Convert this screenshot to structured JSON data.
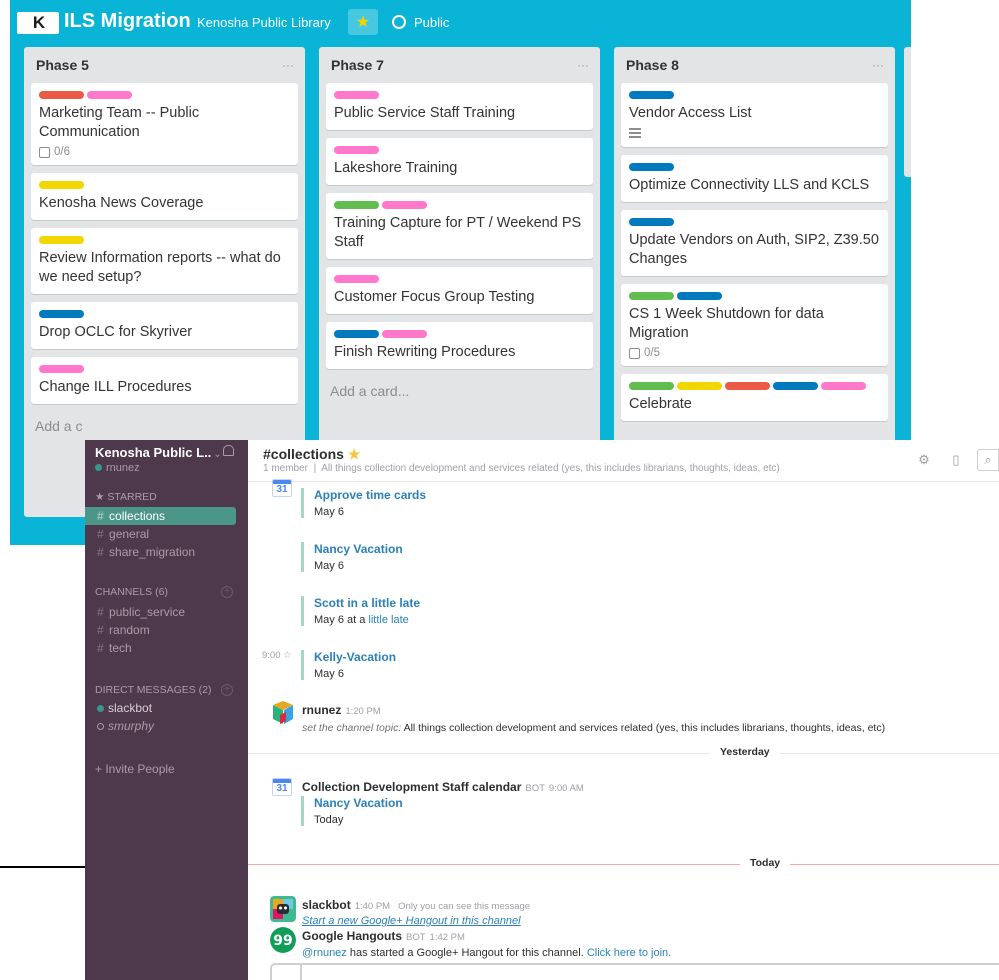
{
  "trello": {
    "logo": "K",
    "board_title": "ILS Migration",
    "org": "Kenosha Public Library",
    "visibility": "Public",
    "colors": {
      "background": "#0ab4d6",
      "green": "#61bd4f",
      "yellow": "#f2d600",
      "red": "#eb5a46",
      "blue": "#0079bf",
      "pink": "#ff78cb"
    },
    "add_card_label": "Add a card...",
    "add_card_partial": "Add a c",
    "lists": [
      {
        "title": "Phase 5",
        "cards": [
          {
            "title": "Marketing Team -- Public Communication",
            "labels": [
              "red",
              "pink"
            ],
            "checklist": "0/6"
          },
          {
            "title": "Kenosha News Coverage",
            "labels": [
              "yellow"
            ]
          },
          {
            "title": "Review Information reports -- what do we need setup?",
            "labels": [
              "yellow"
            ]
          },
          {
            "title": "Drop OCLC for Skyriver",
            "labels": [
              "blue"
            ]
          },
          {
            "title": "Change ILL Procedures",
            "labels": [
              "pink"
            ]
          }
        ]
      },
      {
        "title": "Phase 7",
        "cards": [
          {
            "title": "Public Service Staff Training",
            "labels": [
              "pink"
            ]
          },
          {
            "title": "Lakeshore Training",
            "labels": [
              "pink"
            ]
          },
          {
            "title": "Training Capture for PT / Weekend PS Staff",
            "labels": [
              "green",
              "pink"
            ]
          },
          {
            "title": "Customer Focus Group Testing",
            "labels": [
              "pink"
            ]
          },
          {
            "title": "Finish Rewriting Procedures",
            "labels": [
              "blue",
              "pink"
            ]
          }
        ]
      },
      {
        "title": "Phase 8",
        "cards": [
          {
            "title": "Vendor Access List",
            "labels": [
              "blue"
            ],
            "description": true
          },
          {
            "title": "Optimize Connectivity LLS and KCLS",
            "labels": [
              "blue"
            ]
          },
          {
            "title": "Update Vendors on Auth, SIP2, Z39.50 Changes",
            "labels": [
              "blue"
            ]
          },
          {
            "title": "CS 1 Week Shutdown for data Migration",
            "labels": [
              "green",
              "blue"
            ],
            "checklist": "0/5"
          },
          {
            "title": "Celebrate",
            "labels": [
              "green",
              "yellow",
              "red",
              "blue",
              "pink"
            ]
          }
        ]
      }
    ]
  },
  "slack": {
    "team_name": "Kenosha Public L..",
    "caret": "⌄",
    "username": "rnunez",
    "starred_label": "STARRED",
    "starred": [
      {
        "name": "collections",
        "active": true
      },
      {
        "name": "general"
      },
      {
        "name": "share_migration"
      }
    ],
    "channels_label": "CHANNELS",
    "channels_count": "(6)",
    "channels": [
      "public_service",
      "random",
      "tech"
    ],
    "dm_label": "DIRECT MESSAGES",
    "dm_count": "(2)",
    "dms": [
      {
        "name": "slackbot",
        "status": "online"
      },
      {
        "name": "smurphy",
        "status": "away"
      }
    ],
    "invite": "+ Invite People",
    "channel": {
      "name": "#collections",
      "star": "★",
      "members": "1 member",
      "topic": "All things collection development and services related (yes, this includes librarians, thoughts, ideas, etc)"
    },
    "cal_day": "31",
    "events_top": [
      {
        "title": "Approve time cards",
        "date": "May 6"
      },
      {
        "title": "Nancy Vacation",
        "date": "May 6"
      },
      {
        "title": "Scott in a little late",
        "date_prefix": "May 6 at a ",
        "date_link": "little late"
      },
      {
        "title": "Kelly-Vacation",
        "date": "May 6",
        "time": "9:00",
        "star": "☆"
      }
    ],
    "topic_message": {
      "author": "rnunez",
      "time": "1:20 PM",
      "action": "set the channel topic:",
      "text": "All things collection development and services related (yes, this includes librarians, thoughts, ideas, etc)"
    },
    "divider_yesterday": "Yesterday",
    "calendar_message": {
      "author": "Collection Development Staff calendar",
      "bot": "BOT",
      "time": "9:00 AM",
      "event_title": "Nancy Vacation",
      "event_date": "Today"
    },
    "divider_today": "Today",
    "slackbot_message": {
      "author": "slackbot",
      "time": "1:40 PM",
      "note": "Only you can see this message",
      "link": "Start a new Google+ Hangout in this channel"
    },
    "hangouts_message": {
      "author": "Google Hangouts",
      "bot": "BOT",
      "time": "1:42 PM",
      "mention": "@rnunez",
      "text": " has started a Google+ Hangout for this channel. ",
      "link": "Click here to join."
    },
    "colors": {
      "sidebar": "#4d394b",
      "active": "#4c9689",
      "link": "#2a80b9",
      "event_bar": "#a2d8c4"
    }
  }
}
